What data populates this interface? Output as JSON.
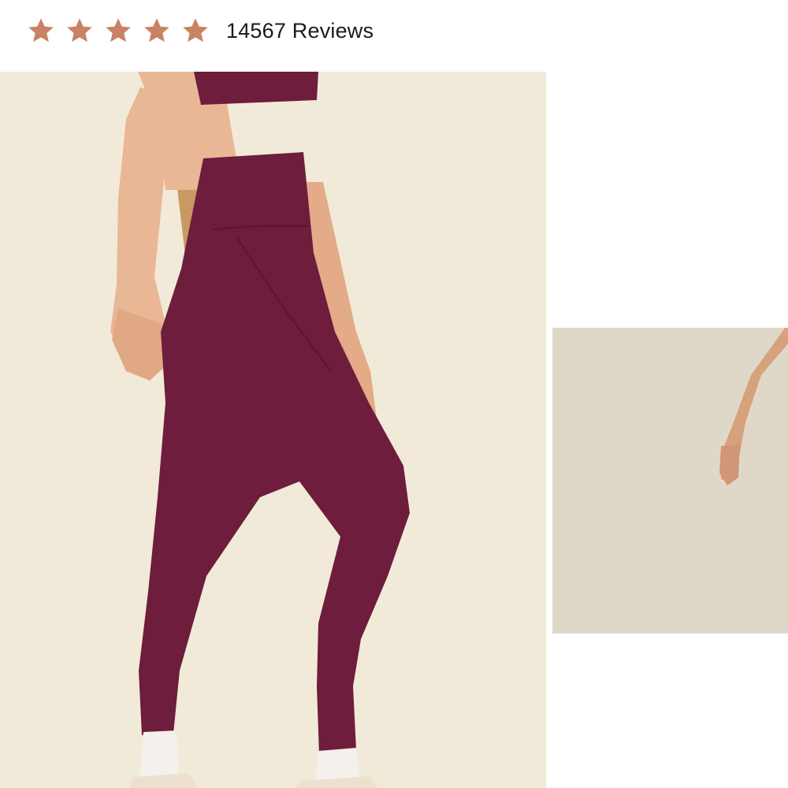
{
  "rating": {
    "stars_filled": 5,
    "stars_total": 5,
    "star_color": "#c98263",
    "reviews_label": "14567 Reviews"
  },
  "gallery": {
    "main_image": {
      "icon": "product-photo",
      "legging_color": "#6e1d3c",
      "background_color": "#f2ead9"
    },
    "next_image": {
      "icon": "product-photo-partial",
      "background_color": "#dfd8c9"
    }
  }
}
